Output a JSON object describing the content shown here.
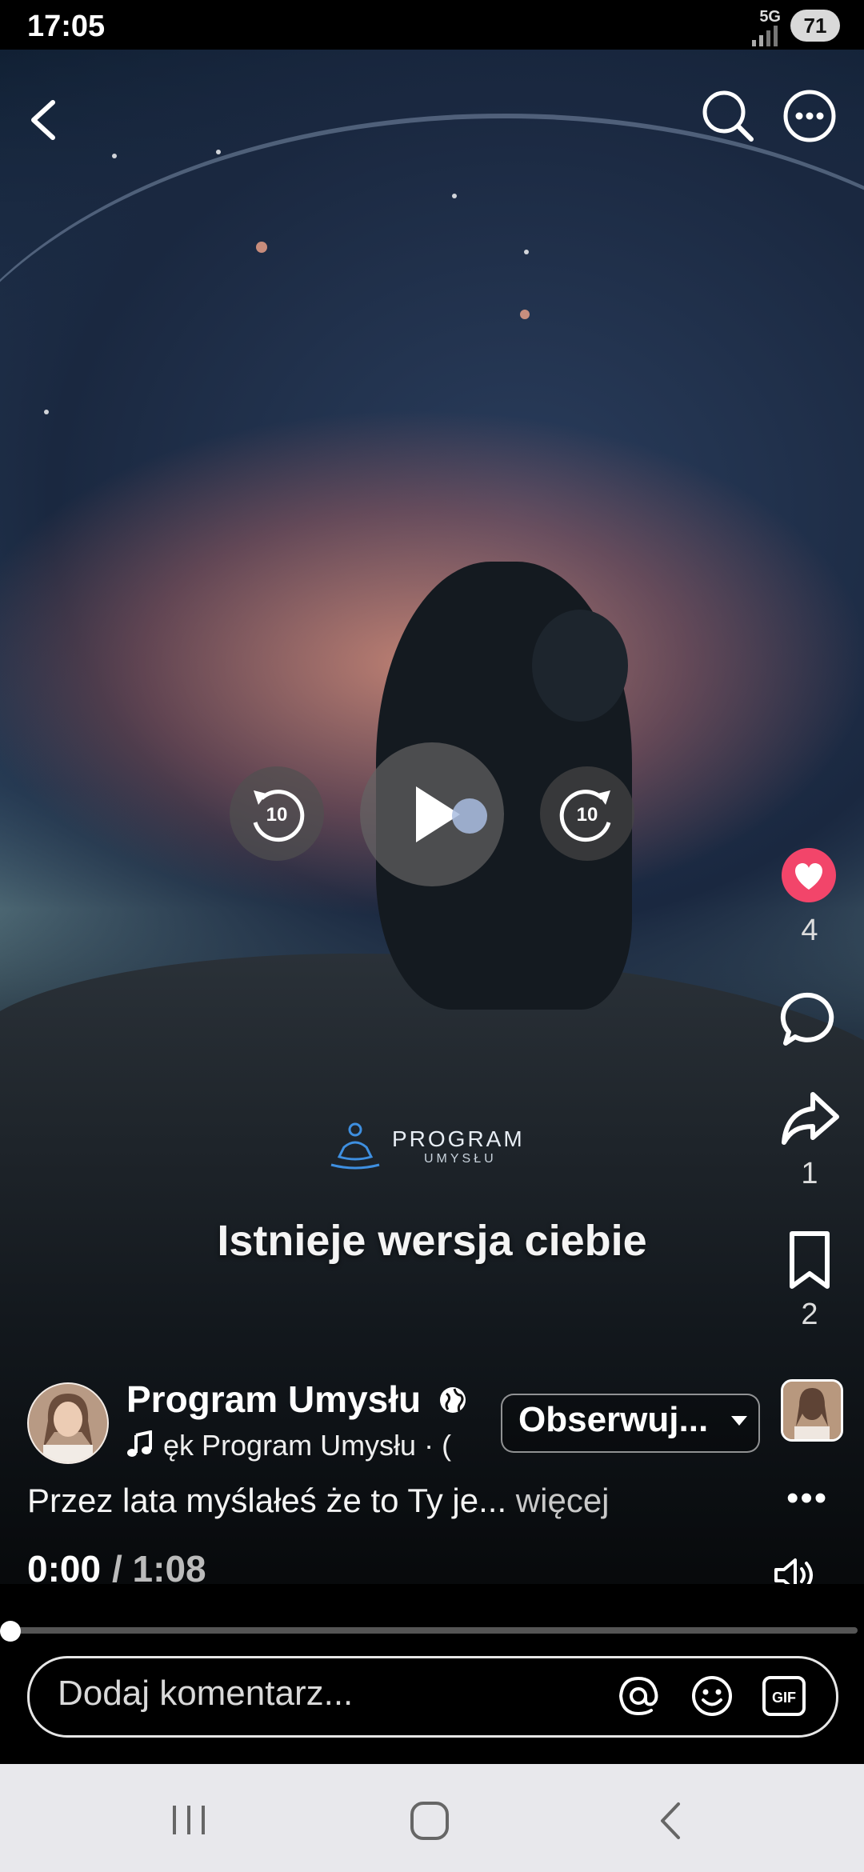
{
  "status_bar": {
    "time": "17:05",
    "network": "5G",
    "battery": "71"
  },
  "top_bar": {
    "back_icon": "chevron-left-icon",
    "search_icon": "search-icon",
    "more_icon": "more-horizontal-circle-icon"
  },
  "player": {
    "seek_back_label": "10",
    "seek_forward_label": "10",
    "play_icon": "play-icon",
    "current_time": "0:00",
    "total_time": "/ 1:08",
    "progress": 0
  },
  "overlay": {
    "logo_line1": "PROGRAM",
    "logo_line2": "UMYSŁU",
    "caption": "Istnieje wersja ciebie"
  },
  "actions": {
    "like_count": "4",
    "share_count": "1",
    "save_count": "2"
  },
  "post": {
    "author_name": "Program Umysłu",
    "audio_text": "ęk   Program Umysłu · (",
    "follow_label": "Obserwuj...",
    "description": "Przez lata myślałeś że to Ty je...",
    "more_label": " więcej"
  },
  "comment": {
    "placeholder": "Dodaj komentarz..."
  },
  "colors": {
    "like": "#f2456a",
    "background": "#000000",
    "navbar": "#e8e8ec"
  }
}
